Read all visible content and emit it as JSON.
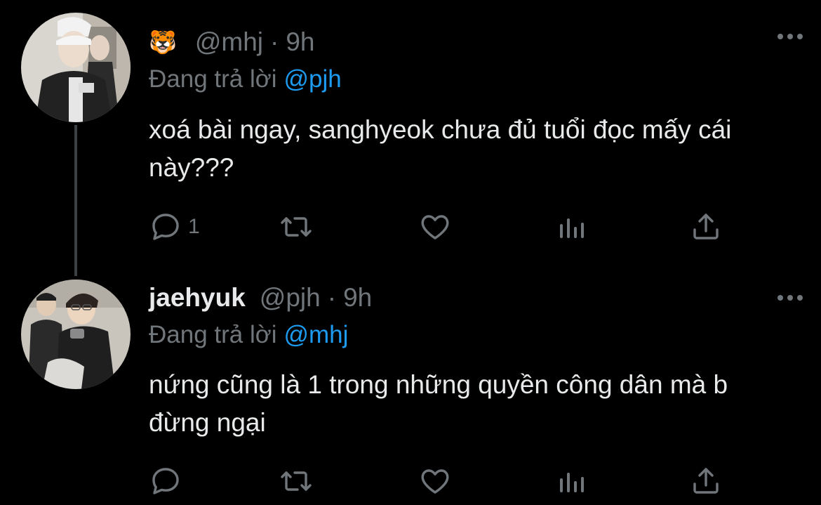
{
  "tweets": [
    {
      "display_name": "🐯",
      "handle": "@mhj",
      "separator": "·",
      "time": "9h",
      "reply_prefix": "Đang trả lời",
      "reply_to": "@pjh",
      "text": "xoá bài ngay, sanghyeok chưa đủ tuổi đọc mấy cái này???",
      "reply_count": "1",
      "icons": [
        "reply-icon",
        "retweet-icon",
        "like-icon",
        "views-icon",
        "share-icon",
        "more-icon"
      ]
    },
    {
      "display_name": "jaehyuk",
      "handle": "@pjh",
      "separator": "·",
      "time": "9h",
      "reply_prefix": "Đang trả lời",
      "reply_to": "@mhj",
      "text": "nứng cũng là 1 trong những quyền công dân mà b đừng ngại",
      "reply_count": "",
      "icons": [
        "reply-icon",
        "retweet-icon",
        "like-icon",
        "views-icon",
        "share-icon",
        "more-icon"
      ]
    }
  ],
  "colors": {
    "background": "#000000",
    "text": "#e7e9ea",
    "muted": "#71767b",
    "mention": "#1d9bf0",
    "thread_line": "#3e4144"
  }
}
